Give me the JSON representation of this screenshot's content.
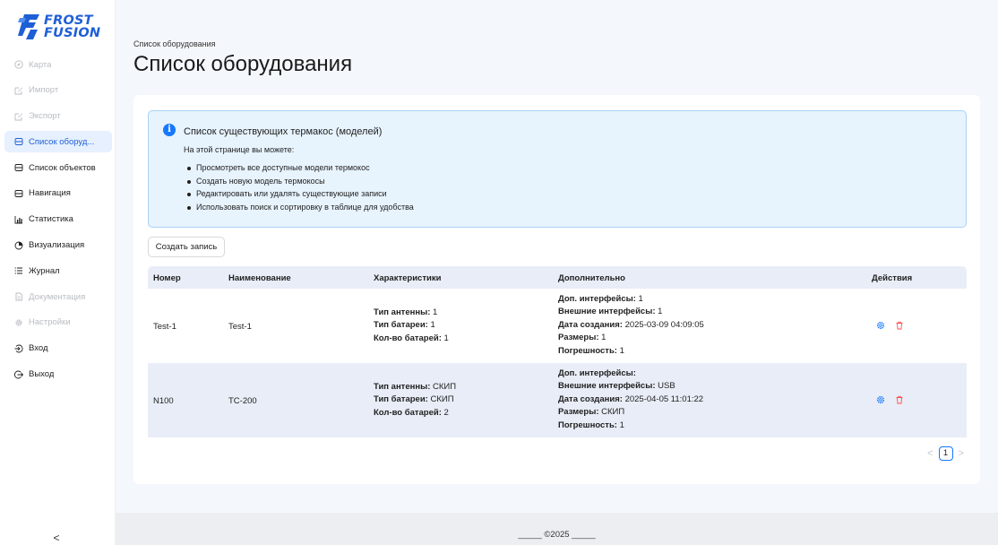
{
  "brand": {
    "line1": "FROST",
    "line2": "FUSION",
    "color": "#1f5fd6"
  },
  "sidebar": {
    "items": [
      {
        "label": "Карта",
        "icon": "compass-icon",
        "state": "disabled"
      },
      {
        "label": "Импорт",
        "icon": "edit-icon",
        "state": "disabled"
      },
      {
        "label": "Экспорт",
        "icon": "edit-icon",
        "state": "disabled"
      },
      {
        "label": "Список оборуд...",
        "icon": "database-icon",
        "state": "active"
      },
      {
        "label": "Список объектов",
        "icon": "database-icon",
        "state": "normal"
      },
      {
        "label": "Навигация",
        "icon": "database-icon",
        "state": "normal"
      },
      {
        "label": "Статистика",
        "icon": "bar-chart-icon",
        "state": "normal"
      },
      {
        "label": "Визуализация",
        "icon": "pie-chart-icon",
        "state": "normal"
      },
      {
        "label": "Журнал",
        "icon": "list-icon",
        "state": "normal"
      },
      {
        "label": "Документация",
        "icon": "document-icon",
        "state": "disabled"
      },
      {
        "label": "Настройки",
        "icon": "gear-icon",
        "state": "disabled"
      },
      {
        "label": "Вход",
        "icon": "login-icon",
        "state": "normal"
      },
      {
        "label": "Выход",
        "icon": "logout-icon",
        "state": "normal"
      }
    ],
    "collapse_glyph": "<"
  },
  "header": {
    "breadcrumb": "Список оборудования",
    "title": "Список оборудования"
  },
  "info": {
    "title": "Список существующих термакос (моделей)",
    "subtitle": "На этой странице вы можете:",
    "bullets": [
      "Просмотреть все доступные модели термокос",
      "Создать новую модель термокосы",
      "Редактировать или удалять существующие записи",
      "Использовать поиск и сортировку в таблице для удобства"
    ]
  },
  "toolbar": {
    "create_label": "Создать запись"
  },
  "table": {
    "columns": [
      "Номер",
      "Наименование",
      "Характеристики",
      "Дополнительно",
      "Действия"
    ],
    "rows": [
      {
        "number": "Test-1",
        "name": "Test-1",
        "chars": [
          {
            "k": "Тип антенны:",
            "v": "1"
          },
          {
            "k": "Тип батареи:",
            "v": "1"
          },
          {
            "k": "Кол-во батарей:",
            "v": "1"
          }
        ],
        "extra": [
          {
            "k": "Доп. интерфейсы:",
            "v": "1"
          },
          {
            "k": "Внешние интерфейсы:",
            "v": "1"
          },
          {
            "k": "Дата создания:",
            "v": "2025-03-09 04:09:05"
          },
          {
            "k": "Размеры:",
            "v": "1"
          },
          {
            "k": "Погрешность:",
            "v": "1"
          }
        ]
      },
      {
        "number": "N100",
        "name": "TC-200",
        "chars": [
          {
            "k": "Тип антенны:",
            "v": "СКИП"
          },
          {
            "k": "Тип батареи:",
            "v": "СКИП"
          },
          {
            "k": "Кол-во батарей:",
            "v": "2"
          }
        ],
        "extra": [
          {
            "k": "Доп. интерфейсы:",
            "v": ""
          },
          {
            "k": "Внешние интерфейсы:",
            "v": "USB"
          },
          {
            "k": "Дата создания:",
            "v": "2025-04-05 11:01:22"
          },
          {
            "k": "Размеры:",
            "v": "СКИП"
          },
          {
            "k": "Погрешность:",
            "v": "1"
          }
        ]
      }
    ]
  },
  "pagination": {
    "prev": "<",
    "current": "1",
    "next": ">"
  },
  "footer": {
    "text": "_____ ©2025 _____"
  },
  "colors": {
    "accent": "#1677ff",
    "danger": "#ff4d4f",
    "info_bg": "#e7f3fd",
    "row_alt": "#e8edf7"
  }
}
